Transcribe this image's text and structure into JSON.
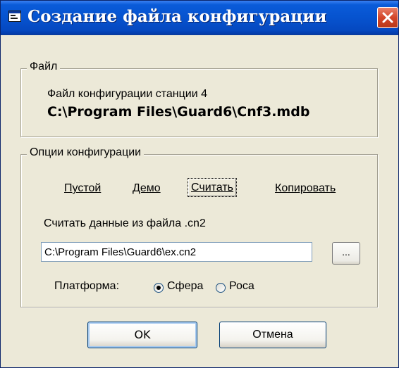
{
  "window": {
    "title": "Создание файла конфигурации",
    "icon": "app-window-icon",
    "close_icon": "close-icon"
  },
  "file_group": {
    "legend": "Файл",
    "station_label": "Файл конфигурации станции 4",
    "path": "C:\\Program Files\\Guard6\\Cnf3.mdb"
  },
  "options_group": {
    "legend": "Опции конфигурации",
    "options": {
      "empty": "Пустой",
      "demo": "Демо",
      "read": "Считать",
      "copy": "Копировать"
    },
    "selected_option": "Считать",
    "read_label": "Считать данные из файла .cn2",
    "cn2_path_value": "C:\\Program Files\\Guard6\\ex.cn2",
    "browse_label": "...",
    "platform_label": "Платформа:",
    "platforms": {
      "sphere": "Сфера",
      "rosa": "Роса"
    },
    "selected_platform": "Сфера"
  },
  "buttons": {
    "ok": "OK",
    "cancel": "Отмена"
  },
  "colors": {
    "titlebar": "#0653cf",
    "close": "#d4462a",
    "background": "#ece9d8"
  }
}
